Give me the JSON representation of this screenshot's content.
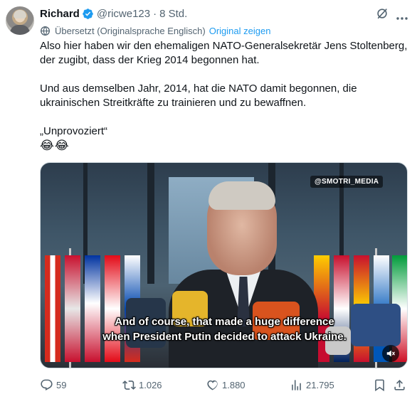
{
  "tweet": {
    "author_name": "Richard",
    "author_handle": "@ricwe123",
    "separator": "·",
    "time": "8 Std.",
    "translated_label": "Übersetzt (Originalsprache Englisch)",
    "show_original": "Original zeigen",
    "text": {
      "line1": "Also hier haben wir den ehemaligen NATO-Generalsekretär Jens Stoltenberg, der zugibt, dass der Krieg 2014 begonnen hat.",
      "line2": "Und aus demselben Jahr, 2014, hat die NATO damit begonnen, die ukrainischen Streitkräfte zu trainieren und zu bewaffnen.",
      "line3": "„Unprovoziert“",
      "emoji": "😂😂"
    },
    "video": {
      "watermark": "@SMOTRI_MEDIA",
      "subtitle_line1": "And of course, that made a huge difference",
      "subtitle_line2": "when President Putin decided to attack Ukraine."
    },
    "stats": {
      "replies": "59",
      "reposts": "1.026",
      "likes": "1.880",
      "views": "21.795"
    }
  },
  "icons": {
    "verified": "verified-badge-icon",
    "grok": "grok-icon",
    "more": "more-icon",
    "translate": "globe-icon",
    "reply": "reply-icon",
    "repost": "repost-icon",
    "like": "heart-icon",
    "views": "views-icon",
    "bookmark": "bookmark-icon",
    "share": "share-icon",
    "mute": "speaker-muted-icon"
  },
  "colors": {
    "text": "#0f1419",
    "secondary": "#536471",
    "accent": "#1d9bf0"
  }
}
